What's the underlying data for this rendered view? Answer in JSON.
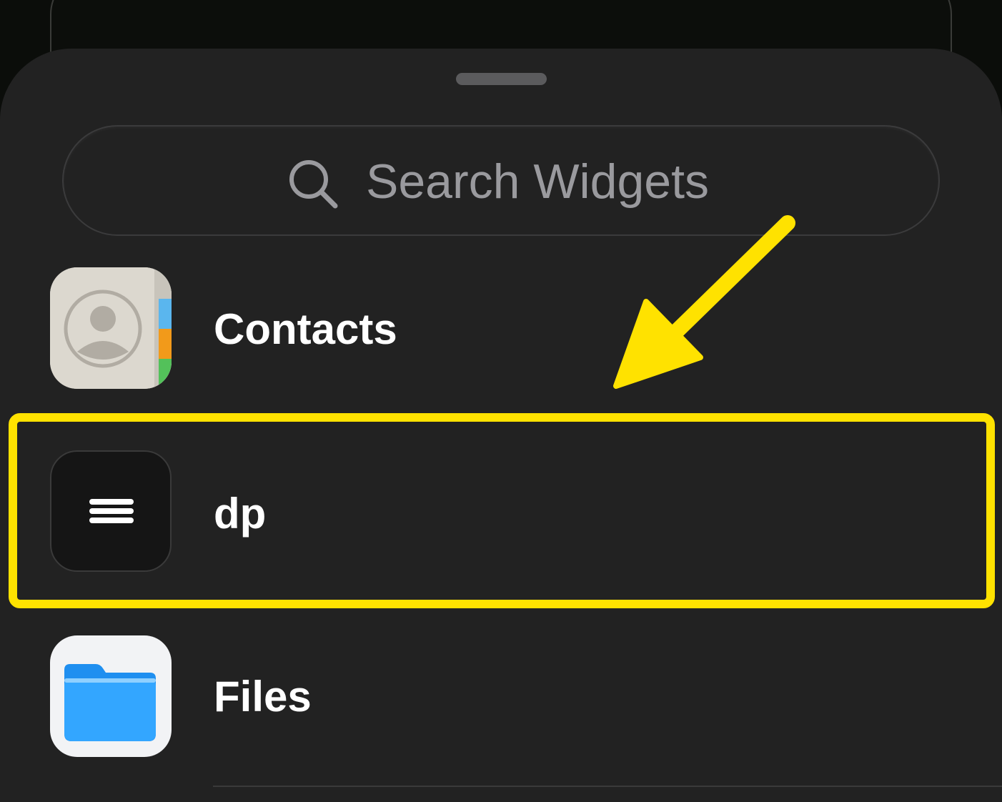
{
  "search": {
    "placeholder": "Search Widgets",
    "icon": "search-icon"
  },
  "apps": [
    {
      "label": "Contacts",
      "icon": "contacts-app-icon"
    },
    {
      "label": "dp",
      "icon": "dp-app-icon"
    },
    {
      "label": "Files",
      "icon": "files-app-icon"
    }
  ],
  "annotation": {
    "color": "#ffe200",
    "highlighted_item": "dp"
  },
  "colors": {
    "sheet_background": "#222222",
    "row_text": "#ffffff",
    "placeholder_text": "#9a9a9e"
  }
}
